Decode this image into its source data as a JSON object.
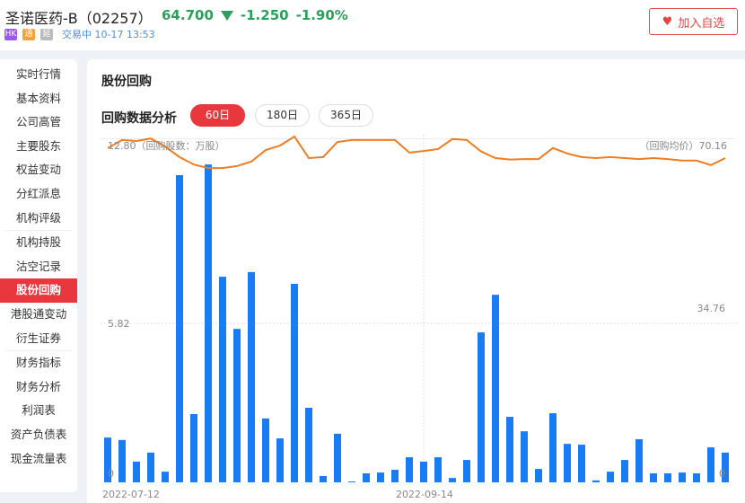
{
  "header": {
    "name": "圣诺医药-B（02257）",
    "price": "64.700",
    "change": "-1.250",
    "change_pct": "-1.90%",
    "badges": [
      "HK",
      "通",
      "延"
    ],
    "status": "交易中 10-17 13:53",
    "add_label": "加入自选"
  },
  "sidebar": {
    "groups": [
      [
        "实时行情",
        "基本资料",
        "公司高管",
        "主要股东",
        "权益变动",
        "分红派息",
        "机构评级"
      ],
      [
        "机构持股",
        "沽空记录",
        "股份回购",
        "港股通变动",
        "衍生证券"
      ],
      [
        "财务指标",
        "财务分析",
        "利润表",
        "资产负债表",
        "现金流量表"
      ]
    ],
    "active": "股份回购"
  },
  "main": {
    "title": "股份回购",
    "subtitle": "回购数据分析",
    "tabs": [
      "60日",
      "180日",
      "365日"
    ],
    "active_tab": "60日"
  },
  "chart_data": {
    "type": "bar+line",
    "left_axis": {
      "label": "（回购股数：万股）",
      "ticks": [
        "12.80",
        "5.82",
        "0"
      ]
    },
    "right_axis": {
      "label": "（回购均价）",
      "ticks": [
        "70.16",
        "34.76",
        "0"
      ]
    },
    "x_labels": [
      "2022-07-12",
      "2022-09-14"
    ],
    "colors": {
      "bar": "#1a7cf5",
      "line": "#ee7d23"
    },
    "series": [
      {
        "name": "回购股数",
        "type": "bar",
        "values": [
          1.64,
          1.55,
          0.76,
          1.09,
          0.39,
          11.25,
          2.5,
          11.64,
          7.53,
          5.62,
          7.7,
          2.34,
          1.61,
          7.27,
          2.73,
          0.23,
          1.78,
          0.03,
          0.33,
          0.36,
          0.46,
          0.92,
          0.76,
          0.92,
          0.16,
          0.82,
          5.49,
          6.87,
          2.4,
          1.87,
          0.49,
          2.53,
          1.41,
          1.38,
          0.07,
          0.39,
          0.82,
          1.58,
          0.33,
          0.33,
          0.36,
          0.33,
          1.28,
          1.09
        ]
      },
      {
        "name": "回购均价",
        "type": "line",
        "values": [
          66.7,
          68.3,
          68.1,
          68.6,
          67.0,
          64.9,
          63.4,
          62.7,
          62.7,
          63.1,
          64.0,
          66.3,
          67.2,
          69.0,
          64.7,
          64.9,
          67.9,
          68.3,
          68.3,
          68.3,
          68.3,
          65.8,
          66.1,
          66.5,
          68.5,
          68.3,
          66.0,
          64.7,
          64.4,
          64.5,
          64.5,
          66.7,
          65.6,
          64.9,
          64.7,
          64.9,
          64.7,
          64.5,
          64.7,
          64.5,
          64.2,
          64.2,
          63.3,
          64.7
        ]
      }
    ]
  }
}
